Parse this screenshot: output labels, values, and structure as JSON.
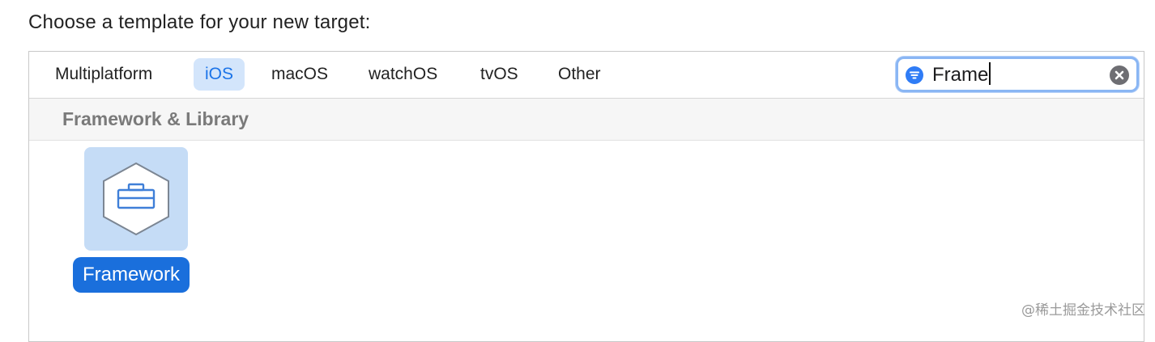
{
  "prompt": "Choose a template for your new target:",
  "tabs": [
    {
      "label": "Multiplatform",
      "selected": false
    },
    {
      "label": "iOS",
      "selected": true
    },
    {
      "label": "macOS",
      "selected": false
    },
    {
      "label": "watchOS",
      "selected": false
    },
    {
      "label": "tvOS",
      "selected": false
    },
    {
      "label": "Other",
      "selected": false
    }
  ],
  "search": {
    "value": "Frame",
    "icon": "filter-icon",
    "clear_icon": "clear-icon"
  },
  "section": {
    "title": "Framework & Library"
  },
  "templates": [
    {
      "label": "Framework",
      "icon": "toolbox-hexagon-icon",
      "selected": true
    }
  ],
  "watermark": "@稀土掘金技术社区",
  "colors": {
    "accent": "#1a6fdc",
    "selected_tab_bg": "#d3e5fb",
    "tile_bg": "#c5dcf6"
  }
}
